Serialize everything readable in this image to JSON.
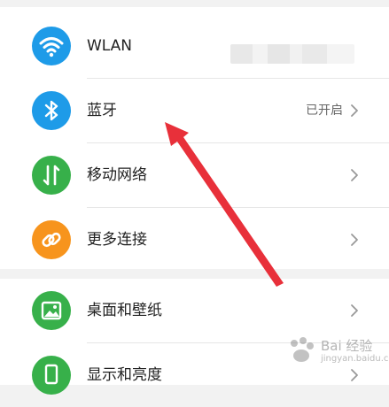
{
  "section1": {
    "items": [
      {
        "label": "WLAN",
        "value": "",
        "icon": "wifi-icon",
        "color": "#1e9be8"
      },
      {
        "label": "蓝牙",
        "value": "已开启",
        "icon": "bluetooth-icon",
        "color": "#1e9be8"
      },
      {
        "label": "移动网络",
        "value": "",
        "icon": "mobile-data-icon",
        "color": "#37b04a"
      },
      {
        "label": "更多连接",
        "value": "",
        "icon": "link-icon",
        "color": "#f7941d"
      }
    ]
  },
  "section2": {
    "items": [
      {
        "label": "桌面和壁纸",
        "value": "",
        "icon": "wallpaper-icon",
        "color": "#37b04a"
      },
      {
        "label": "显示和亮度",
        "value": "",
        "icon": "display-icon",
        "color": "#37b04a"
      }
    ]
  },
  "colors": {
    "background": "#f2f2f2",
    "card": "#ffffff",
    "annotation_arrow": "#e8303a"
  },
  "watermark": {
    "text": "Bai 经验",
    "sub": "jingyan.baidu.com"
  }
}
